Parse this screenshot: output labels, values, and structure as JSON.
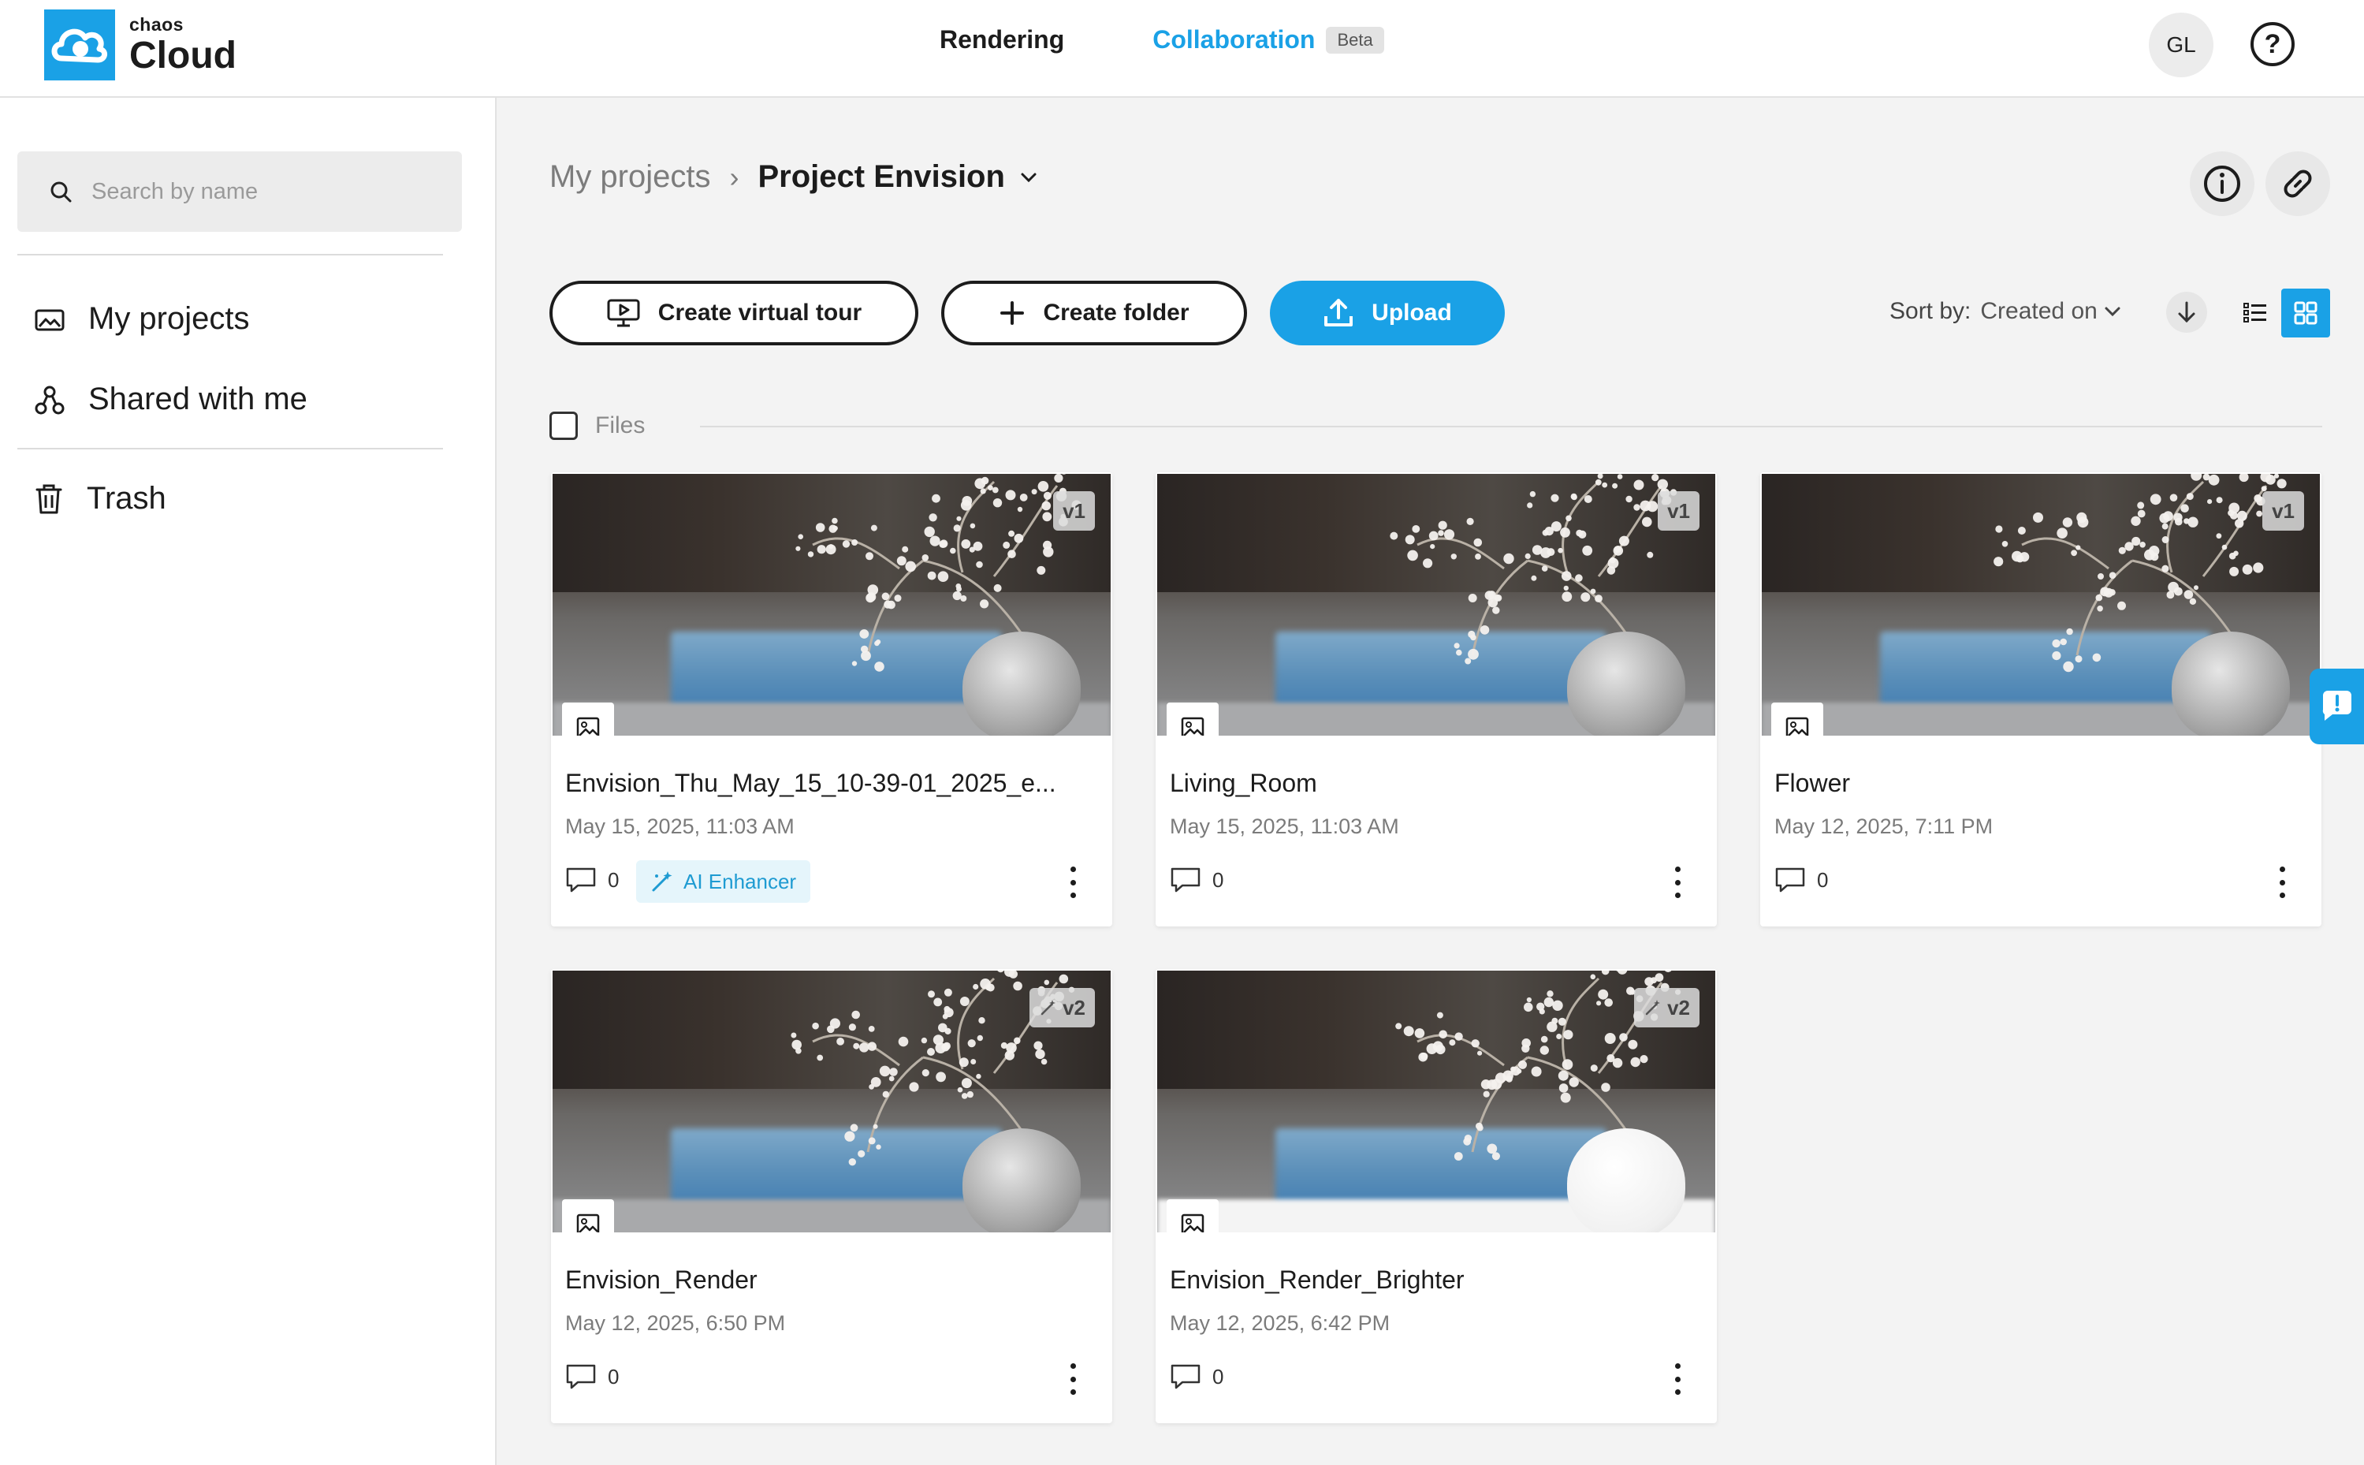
{
  "header": {
    "logo_small": "chaos",
    "logo_big": "Cloud",
    "nav": [
      {
        "label": "Rendering"
      },
      {
        "label": "Collaboration",
        "badge": "Beta"
      }
    ],
    "avatar_initials": "GL",
    "help_icon": "help-icon"
  },
  "sidebar": {
    "search_placeholder": "Search by name",
    "items": [
      {
        "label": "My projects",
        "icon": "image-folder-icon"
      },
      {
        "label": "Shared with me",
        "icon": "share-icon"
      },
      {
        "label": "Trash",
        "icon": "trash-icon"
      }
    ]
  },
  "breadcrumb": {
    "parent": "My projects",
    "current": "Project Envision"
  },
  "toolbar": {
    "virtual_tour_label": "Create virtual tour",
    "create_folder_label": "Create folder",
    "upload_label": "Upload",
    "sort_label": "Sort by:",
    "sort_value": "Created on"
  },
  "files_header": {
    "label": "Files"
  },
  "cards": [
    {
      "title": "Envision_Thu_May_15_10-39-01_2025_e...",
      "date": "May 15, 2025, 11:03 AM",
      "version": "v1",
      "ai_version": false,
      "comments": "0",
      "chip": "AI Enhancer",
      "bright": false
    },
    {
      "title": "Living_Room",
      "date": "May 15, 2025, 11:03 AM",
      "version": "v1",
      "ai_version": false,
      "comments": "0",
      "chip": "",
      "bright": false
    },
    {
      "title": "Flower",
      "date": "May 12, 2025, 7:11 PM",
      "version": "v1",
      "ai_version": false,
      "comments": "0",
      "chip": "",
      "bright": false
    },
    {
      "title": "Envision_Render",
      "date": "May 12, 2025, 6:50 PM",
      "version": "v2",
      "ai_version": true,
      "comments": "0",
      "chip": "",
      "bright": false
    },
    {
      "title": "Envision_Render_Brighter",
      "date": "May 12, 2025, 6:42 PM",
      "version": "v2",
      "ai_version": true,
      "comments": "0",
      "chip": "",
      "bright": true
    }
  ],
  "colors": {
    "accent": "#1aa1e6",
    "background": "#f3f3f3",
    "chip_bg": "#e5f5fb"
  }
}
